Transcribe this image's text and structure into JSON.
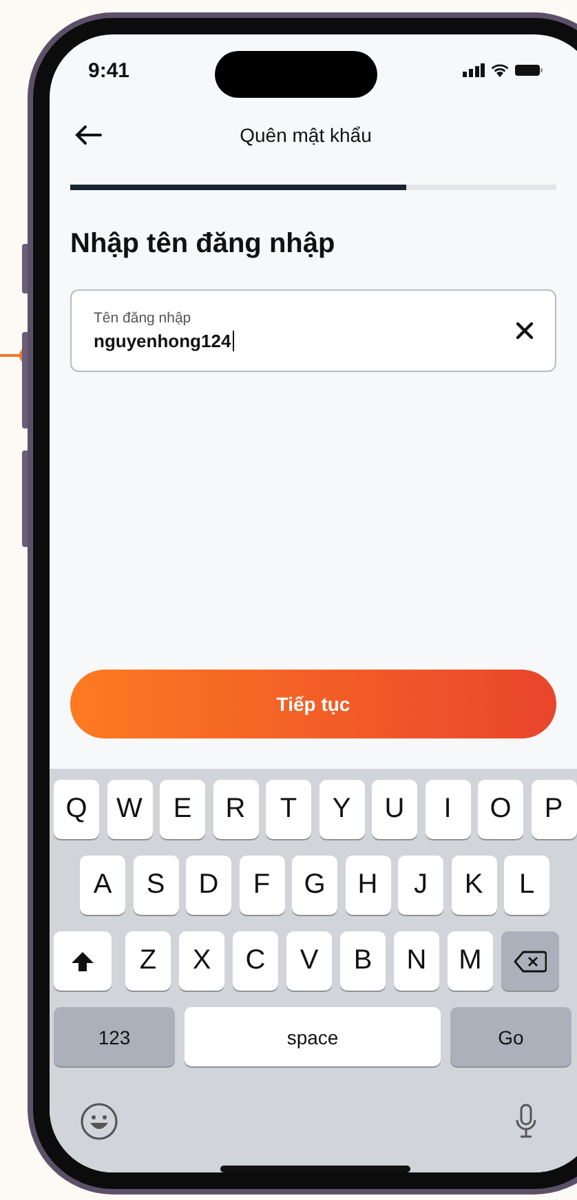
{
  "status_bar": {
    "time": "9:41"
  },
  "nav": {
    "title": "Quên mật khẩu"
  },
  "progress": {
    "level": 0.69
  },
  "heading": "Nhập tên đăng nhập",
  "field": {
    "label": "Tên đăng nhập",
    "value": "nguyenhong124"
  },
  "button": {
    "label": "Tiếp tục"
  },
  "keyboard": {
    "letter_rows": [
      [
        {
          "kind": "letter",
          "label": "Q"
        },
        {
          "kind": "letter",
          "label": "W"
        },
        {
          "kind": "letter",
          "label": "E"
        },
        {
          "kind": "letter",
          "label": "R"
        },
        {
          "kind": "letter",
          "label": "T"
        },
        {
          "kind": "letter",
          "label": "Y"
        },
        {
          "kind": "letter",
          "label": "U"
        },
        {
          "kind": "letter",
          "label": "I"
        },
        {
          "kind": "letter",
          "label": "O"
        },
        {
          "kind": "letter",
          "label": "P"
        }
      ],
      [
        {
          "kind": "letter",
          "label": "A"
        },
        {
          "kind": "letter",
          "label": "S"
        },
        {
          "kind": "letter",
          "label": "D"
        },
        {
          "kind": "letter",
          "label": "F"
        },
        {
          "kind": "letter",
          "label": "G"
        },
        {
          "kind": "letter",
          "label": "H"
        },
        {
          "kind": "letter",
          "label": "J"
        },
        {
          "kind": "letter",
          "label": "K"
        },
        {
          "kind": "letter",
          "label": "L"
        }
      ],
      [
        {
          "kind": "shift"
        },
        {
          "kind": "letter",
          "label": "Z"
        },
        {
          "kind": "letter",
          "label": "X"
        },
        {
          "kind": "letter",
          "label": "C"
        },
        {
          "kind": "letter",
          "label": "V"
        },
        {
          "kind": "letter",
          "label": "B"
        },
        {
          "kind": "letter",
          "label": "N"
        },
        {
          "kind": "letter",
          "label": "M"
        },
        {
          "kind": "delete"
        }
      ]
    ],
    "bottom_keys": [
      {
        "kind": "function",
        "label": "123"
      },
      {
        "kind": "space",
        "label": "space"
      },
      {
        "kind": "function",
        "label": "Go"
      }
    ]
  }
}
